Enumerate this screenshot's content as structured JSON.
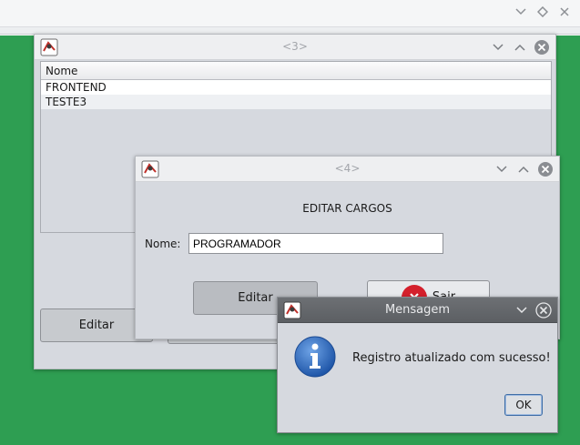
{
  "desktop": {
    "background_color": "#2e9e52",
    "topbar_icons": [
      "chevron-down-icon",
      "diamond-icon",
      "close-icon"
    ]
  },
  "window3": {
    "title": "<3>",
    "table": {
      "columns": [
        "Nome"
      ],
      "rows": [
        "FRONTEND",
        "TESTE3"
      ]
    },
    "edit_label": "Editar"
  },
  "window4": {
    "title": "<4>",
    "heading": "EDITAR CARGOS",
    "name_label": "Nome:",
    "name_value": "PROGRAMADOR",
    "edit_label": "Editar",
    "exit_label": "Sair"
  },
  "dialog": {
    "title": "Mensagem",
    "message": "Registro atualizado com sucesso!",
    "ok_label": "OK",
    "icon": "info-icon"
  }
}
